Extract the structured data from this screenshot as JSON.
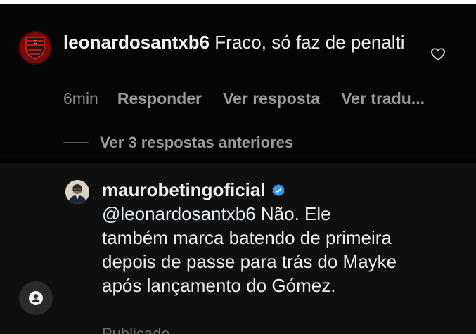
{
  "comment": {
    "username": "leonardosantxb6",
    "text": " Fraco, só faz de penalti",
    "time": "6min",
    "actions": [
      "Responder",
      "Ver resposta",
      "Ver tradu..."
    ],
    "avatar_icon": "flamengo-crest-icon",
    "like_icon": "heart-outline-icon"
  },
  "replies_toggle": {
    "label": "Ver 3 respostas anteriores"
  },
  "reply": {
    "username": "maurobetingoficial",
    "verified_icon": "verified-badge-icon",
    "mention": "@leonardosantxb6",
    "text": " Não. Ele também marca batendo de primeira depois de passe para trás do Mayke após lançamento do Gómez.",
    "cut_text": "Publicado..."
  },
  "floating_button": {
    "icon": "person-icon"
  },
  "colors": {
    "background": "#000000",
    "reply_background": "#0f0f0f",
    "muted_text": "#8e8e8e",
    "verified_blue": "#3897f0",
    "crest_red": "#b31010"
  }
}
